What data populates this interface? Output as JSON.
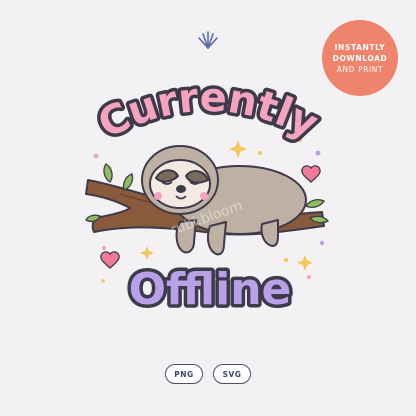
{
  "badge": {
    "line1": "INSTANTLY",
    "line2": "DOWNLOAD",
    "line3": "AND PRINT",
    "color": "#f0836c"
  },
  "design": {
    "title_top": "Currently",
    "title_bottom": "Offline",
    "watermark": "rubi.bloom",
    "top_color": "#f5a3bf",
    "bottom_color": "#b8a1e6",
    "outline_color": "#3d3a4a"
  },
  "formats": {
    "png_label": "PNG",
    "svg_label": "SVG"
  },
  "colors": {
    "background": "#f4f1f5",
    "logo": "#5a6bb0",
    "branch": "#8a5a3c",
    "leaf": "#8dbf5a",
    "sloth": "#bfb0a4",
    "heart": "#f07a98",
    "sparkle": "#f3c75a"
  },
  "icons": [
    "fan-logo-icon",
    "heart-icon",
    "sparkle-icon",
    "leaf-icon"
  ]
}
